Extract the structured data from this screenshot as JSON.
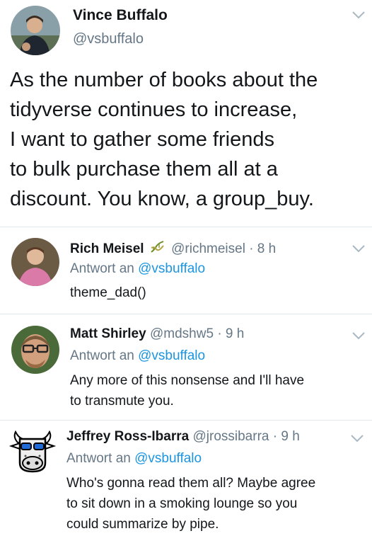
{
  "main_tweet": {
    "name": "Vince Buffalo",
    "handle": "@vsbuffalo",
    "text_lines": [
      "As the number of books about the",
      "tidyverse continues to increase,",
      "I want to gather some friends",
      "to bulk purchase them all at a",
      "discount. You know, a group_buy."
    ]
  },
  "replies": [
    {
      "name": "Rich Meisel",
      "handle": "@richmeisel",
      "time": "· 8 h",
      "reply_prefix": "Antwort an",
      "reply_to": "@vsbuffalo",
      "text_lines": [
        "theme_dad()"
      ]
    },
    {
      "name": "Matt Shirley",
      "handle": "@mdshw5",
      "time": "· 9 h",
      "reply_prefix": "Antwort an",
      "reply_to": "@vsbuffalo",
      "text_lines": [
        "Any more of this nonsense and I'll have",
        "to transmute you."
      ]
    },
    {
      "name": "Jeffrey Ross-Ibarra",
      "handle": "@jrossibarra",
      "time": "· 9 h",
      "reply_prefix": "Antwort an",
      "reply_to": "@vsbuffalo",
      "text_lines": [
        "Who's gonna read them all? Maybe agree",
        "to sit down in a smoking lounge so you",
        "could summarize by pipe."
      ]
    }
  ],
  "colors": {
    "text": "#14171a",
    "secondary": "#657786",
    "link": "#1b95e0",
    "divider": "#e1e8ed"
  },
  "icons": [
    "chevron-down-icon",
    "dna-icon"
  ]
}
